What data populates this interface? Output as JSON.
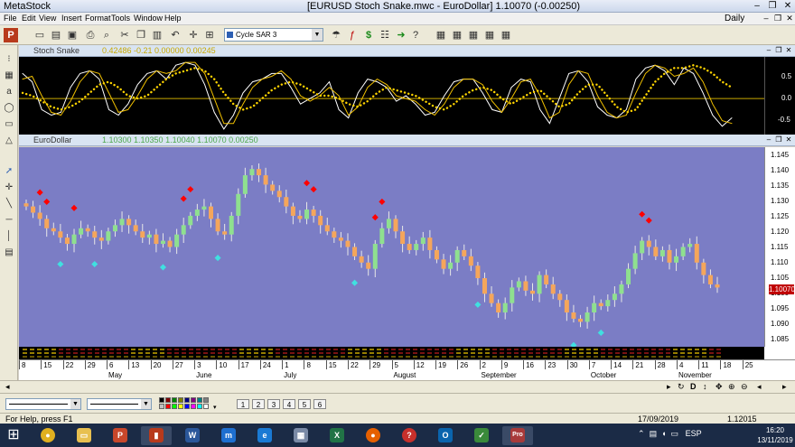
{
  "window": {
    "app_title": "MetaStock",
    "doc_title": "[EURUSD Stoch Snake.mwc - EuroDollar]   1.10070 (-0.00250)",
    "min": "–",
    "max": "❐",
    "close": "✕"
  },
  "menu": {
    "items": [
      "File",
      "Edit",
      "View",
      "Insert",
      "Format",
      "Tools",
      "Window",
      "Help"
    ],
    "period": "Daily"
  },
  "toolbar": {
    "indicator_combo": "Cycle SAR 3"
  },
  "panel_stoch": {
    "title": "Stoch Snake",
    "values": "0.42486   -0.21   0.00000   0.00245",
    "axis": [
      "0.5",
      "0.0",
      "-0.5"
    ]
  },
  "panel_price": {
    "title": "EuroDollar",
    "values": "1.10300  1.10350  1.10040  1.10070  0.00250",
    "axis": [
      "1.145",
      "1.140",
      "1.135",
      "1.130",
      "1.125",
      "1.120",
      "1.115",
      "1.110",
      "1.105",
      "1.100",
      "1.095",
      "1.090",
      "1.085"
    ],
    "last_price": "1.10070"
  },
  "date_axis": {
    "days": [
      "8",
      "15",
      "22",
      "29",
      "6",
      "13",
      "20",
      "27",
      "3",
      "10",
      "17",
      "24",
      "1",
      "8",
      "15",
      "22",
      "29",
      "5",
      "12",
      "19",
      "26",
      "2",
      "9",
      "16",
      "23",
      "30",
      "7",
      "14",
      "21",
      "28",
      "4",
      "11",
      "18",
      "25"
    ],
    "months": [
      "May",
      "June",
      "July",
      "August",
      "September",
      "October",
      "November"
    ]
  },
  "status": {
    "help": "For Help, press F1",
    "date": "17/09/2019",
    "price": "1.12015"
  },
  "scroll_controls": [
    "↻",
    "D",
    "↕",
    "✥",
    "⊕",
    "⊖",
    "◂",
    "▸"
  ],
  "layout_buttons": [
    "1",
    "2",
    "3",
    "4",
    "5",
    "6"
  ],
  "taskbar": {
    "lang": "ESP",
    "time": "16:20",
    "date": "13/11/2019"
  },
  "chart_data": [
    {
      "type": "line",
      "title": "Stoch Snake",
      "ylim": [
        -0.65,
        0.75
      ],
      "series": [
        {
          "values": [
            0.45,
            0.3,
            -0.2,
            -0.3,
            -0.25,
            0.2,
            0.45,
            0.5,
            0.35,
            -0.2,
            -0.3,
            -0.1,
            0.25,
            0.45,
            0.5,
            0.35,
            0.6,
            0.65,
            0.6,
            0.25,
            -0.25,
            -0.55,
            -0.3,
            0.1,
            0.3,
            0.35,
            0.45,
            0.45,
            0.2,
            -0.1,
            0.0,
            0.1,
            0.3,
            -0.2,
            -0.35,
            0.1,
            0.35,
            0.3,
            0.2,
            -0.05,
            0.05,
            -0.1,
            -0.3,
            -0.25,
            0.05,
            0.3,
            0.35,
            0.35,
            0.1,
            -0.2,
            -0.25,
            0.2,
            0.35,
            0.3,
            -0.2,
            -0.45,
            0.0,
            0.45,
            0.5,
            0.3,
            -0.15,
            -0.3,
            -0.35,
            -0.2,
            0.35,
            0.55,
            0.6,
            0.5,
            0.25,
            0.55,
            0.45,
            0.1,
            -0.3,
            -0.5,
            -0.35
          ]
        },
        {
          "values": [
            0.35,
            0.4,
            0.05,
            -0.25,
            -0.3,
            -0.05,
            0.3,
            0.5,
            0.45,
            0.1,
            -0.25,
            -0.2,
            0.05,
            0.35,
            0.5,
            0.45,
            0.5,
            0.65,
            0.65,
            0.45,
            0.0,
            -0.45,
            -0.45,
            -0.1,
            0.2,
            0.35,
            0.4,
            0.5,
            0.35,
            0.05,
            -0.05,
            0.05,
            0.2,
            0.05,
            -0.3,
            -0.15,
            0.2,
            0.35,
            0.25,
            0.05,
            0.0,
            -0.05,
            -0.2,
            -0.3,
            -0.1,
            0.2,
            0.35,
            0.35,
            0.25,
            -0.05,
            -0.25,
            0.0,
            0.3,
            0.35,
            0.05,
            -0.35,
            -0.25,
            0.25,
            0.5,
            0.45,
            0.05,
            -0.25,
            -0.35,
            -0.3,
            0.1,
            0.45,
            0.6,
            0.55,
            0.4,
            0.45,
            0.55,
            0.3,
            -0.1,
            -0.4,
            -0.45
          ]
        },
        {
          "values": [
            0.1,
            0.05,
            -0.05,
            -0.15,
            -0.2,
            -0.15,
            -0.05,
            0.1,
            0.25,
            0.3,
            0.2,
            0.05,
            0.0,
            0.05,
            0.2,
            0.35,
            0.45,
            0.5,
            0.55,
            0.5,
            0.35,
            0.1,
            -0.1,
            -0.2,
            -0.15,
            0.0,
            0.15,
            0.25,
            0.3,
            0.25,
            0.15,
            0.05,
            0.05,
            0.0,
            -0.1,
            -0.15,
            -0.05,
            0.1,
            0.2,
            0.15,
            0.1,
            0.05,
            -0.05,
            -0.15,
            -0.2,
            -0.1,
            0.05,
            0.15,
            0.2,
            0.15,
            0.0,
            -0.1,
            0.0,
            0.1,
            0.15,
            0.0,
            -0.15,
            -0.1,
            0.1,
            0.25,
            0.25,
            0.05,
            -0.15,
            -0.25,
            -0.2,
            0.05,
            0.3,
            0.45,
            0.55,
            0.55,
            0.6,
            0.55,
            0.45,
            0.3,
            0.2
          ]
        }
      ]
    },
    {
      "type": "candlestick",
      "title": "EuroDollar",
      "ylim": [
        1.083,
        1.147
      ],
      "values": [
        1.128,
        1.126,
        1.124,
        1.121,
        1.12,
        1.118,
        1.116,
        1.119,
        1.121,
        1.12,
        1.118,
        1.117,
        1.12,
        1.122,
        1.124,
        1.122,
        1.12,
        1.118,
        1.119,
        1.116,
        1.117,
        1.115,
        1.119,
        1.122,
        1.125,
        1.127,
        1.128,
        1.124,
        1.12,
        1.119,
        1.125,
        1.132,
        1.138,
        1.14,
        1.138,
        1.135,
        1.133,
        1.131,
        1.128,
        1.125,
        1.124,
        1.127,
        1.125,
        1.122,
        1.12,
        1.118,
        1.117,
        1.115,
        1.112,
        1.11,
        1.108,
        1.116,
        1.121,
        1.124,
        1.12,
        1.116,
        1.114,
        1.116,
        1.118,
        1.114,
        1.111,
        1.108,
        1.11,
        1.114,
        1.112,
        1.109,
        1.105,
        1.1,
        1.097,
        1.094,
        1.097,
        1.102,
        1.104,
        1.101,
        1.1,
        1.106,
        1.103,
        1.1,
        1.098,
        1.094,
        1.092,
        1.091,
        1.094,
        1.097,
        1.096,
        1.098,
        1.1,
        1.103,
        1.108,
        1.113,
        1.117,
        1.115,
        1.112,
        1.114,
        1.11,
        1.112,
        1.115,
        1.116,
        1.11,
        1.106,
        1.103,
        1.102
      ],
      "markers": [
        {
          "kind": "red",
          "i": 2
        },
        {
          "kind": "red",
          "i": 3
        },
        {
          "kind": "red",
          "i": 7
        },
        {
          "kind": "red",
          "i": 23
        },
        {
          "kind": "red",
          "i": 24
        },
        {
          "kind": "red",
          "i": 41
        },
        {
          "kind": "red",
          "i": 42
        },
        {
          "kind": "red",
          "i": 51
        },
        {
          "kind": "red",
          "i": 52
        },
        {
          "kind": "red",
          "i": 90
        },
        {
          "kind": "red",
          "i": 91
        },
        {
          "kind": "cyan",
          "i": 5
        },
        {
          "kind": "cyan",
          "i": 10
        },
        {
          "kind": "cyan",
          "i": 20
        },
        {
          "kind": "cyan",
          "i": 28
        },
        {
          "kind": "cyan",
          "i": 48
        },
        {
          "kind": "cyan",
          "i": 66
        },
        {
          "kind": "cyan",
          "i": 80
        },
        {
          "kind": "cyan",
          "i": 84
        }
      ]
    }
  ]
}
